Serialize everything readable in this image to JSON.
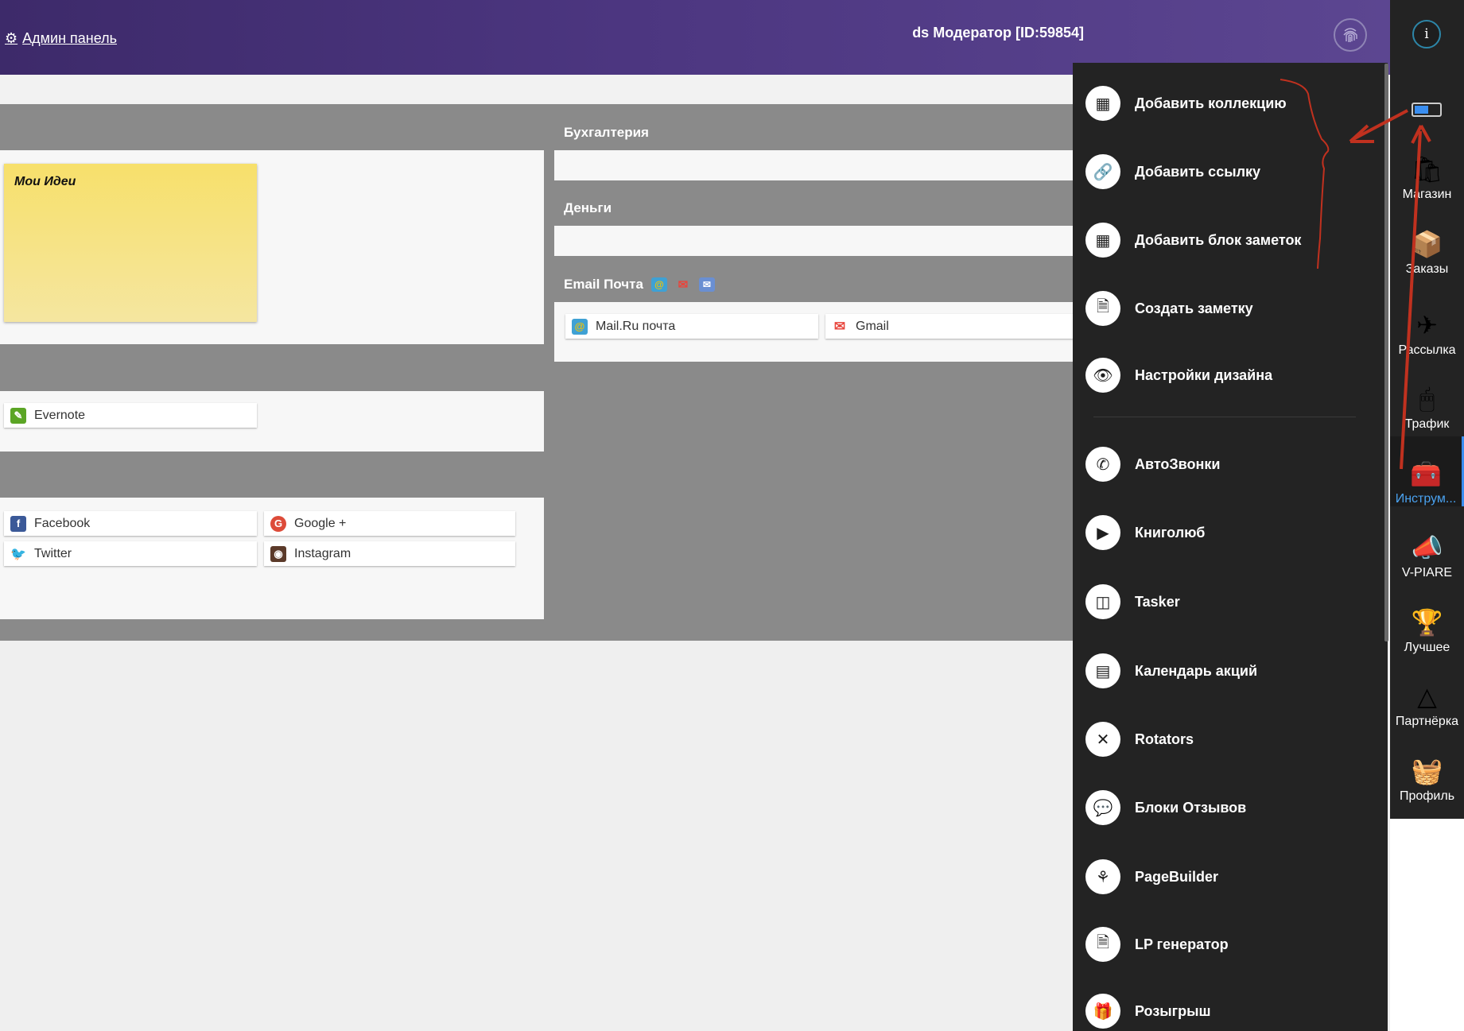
{
  "header": {
    "admin_label": "Админ панель",
    "user_label": "ds Модератор [ID:59854]"
  },
  "panels": {
    "notes_sticky_title": "Мои Идеи",
    "evernote": "Evernote",
    "social": {
      "facebook": "Facebook",
      "google": "Google +",
      "twitter": "Twitter",
      "instagram": "Instagram"
    },
    "accounting": "Бухгалтерия",
    "money": "Деньги",
    "email": {
      "title": "Email Почта",
      "mailru": "Mail.Ru почта",
      "gmail": "Gmail"
    }
  },
  "menu": {
    "items": [
      {
        "label": "Добавить коллекцию",
        "icon": "grid-icon"
      },
      {
        "label": "Добавить ссылку",
        "icon": "link-icon"
      },
      {
        "label": "Добавить блок заметок",
        "icon": "grid-icon"
      },
      {
        "label": "Создать заметку",
        "icon": "file-icon"
      },
      {
        "label": "Настройки дизайна",
        "icon": "eye-icon"
      },
      {
        "label": "АвтоЗвонки",
        "icon": "phone-icon"
      },
      {
        "label": "Книголюб",
        "icon": "video-icon"
      },
      {
        "label": "Tasker",
        "icon": "board-icon"
      },
      {
        "label": "Календарь акций",
        "icon": "calendar-icon"
      },
      {
        "label": "Rotators",
        "icon": "arrows-icon"
      },
      {
        "label": "Блоки Отзывов",
        "icon": "comments-icon"
      },
      {
        "label": "PageBuilder",
        "icon": "sprout-icon"
      },
      {
        "label": "LP генератор",
        "icon": "file-icon"
      },
      {
        "label": "Розыгрыш",
        "icon": "gift-icon"
      }
    ]
  },
  "sidebar": {
    "info": "i",
    "items": [
      {
        "label": "Магазин",
        "icon": "shopping-bag-icon"
      },
      {
        "label": "Заказы",
        "icon": "boxes-icon"
      },
      {
        "label": "Рассылка",
        "icon": "paper-plane-icon"
      },
      {
        "label": "Трафик",
        "icon": "mouse-icon"
      },
      {
        "label": "Инструм...",
        "icon": "toolbox-icon"
      },
      {
        "label": "V-PIARE",
        "icon": "megaphone-icon"
      },
      {
        "label": "Лучшее",
        "icon": "award-icon"
      },
      {
        "label": "Партнёрка",
        "icon": "pyramid-icon"
      },
      {
        "label": "Профиль",
        "icon": "basket-icon"
      }
    ]
  },
  "colors": {
    "header_start": "#3d2a6a",
    "header_end": "#5c4691",
    "menu_bg": "#232323",
    "active_accent": "#3a8ef0",
    "annotation": "#c0311f"
  }
}
